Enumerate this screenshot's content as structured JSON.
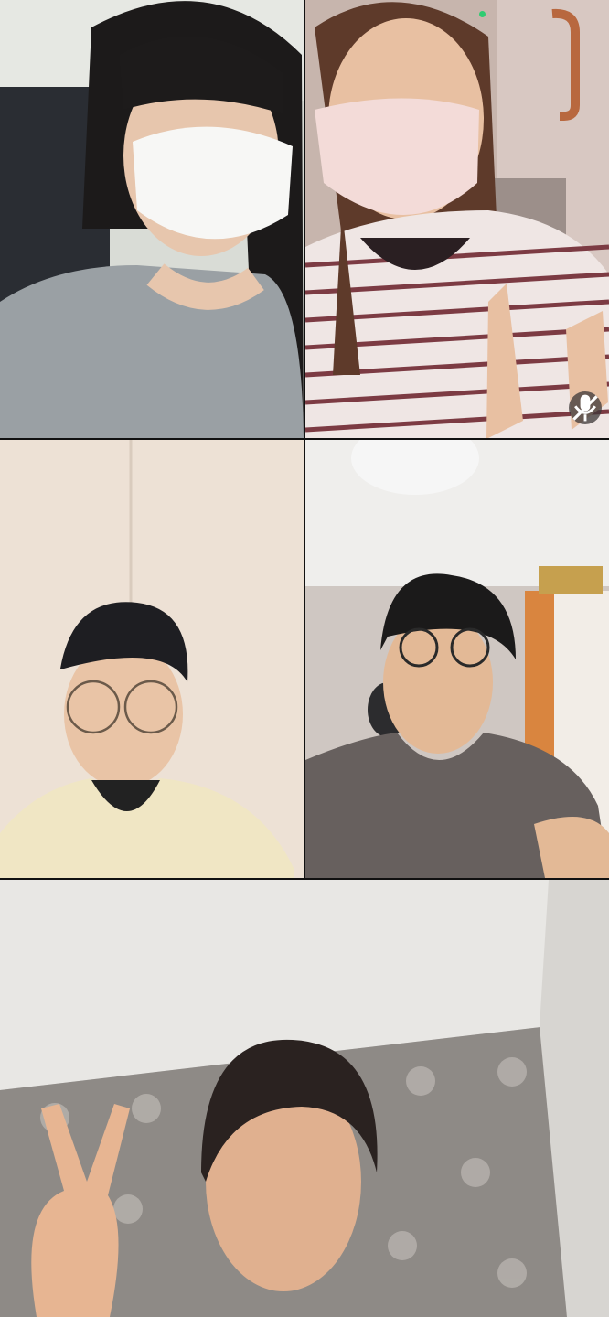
{
  "call": {
    "participants": [
      {
        "id": "p1",
        "muted": false
      },
      {
        "id": "p2",
        "muted": true,
        "active_speaker_color": "#2ecc71"
      },
      {
        "id": "p3",
        "muted": false
      },
      {
        "id": "p4",
        "muted": false
      },
      {
        "id": "p5",
        "muted": false
      }
    ]
  },
  "icons": {
    "mute": "mic-off-icon"
  }
}
